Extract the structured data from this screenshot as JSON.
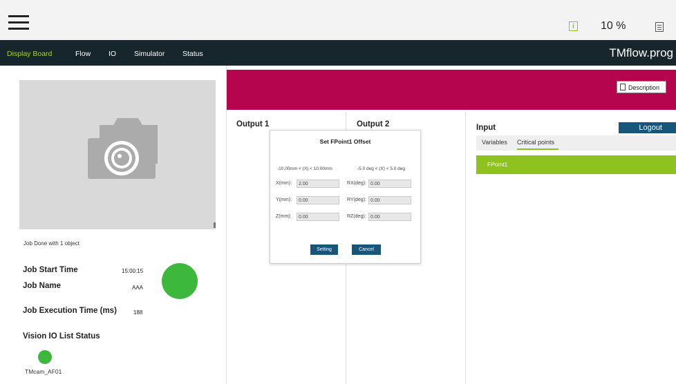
{
  "topbar": {
    "speed": "10 %"
  },
  "nav": {
    "items": [
      "Display Board",
      "Flow",
      "IO",
      "Simulator",
      "Status"
    ],
    "program_name": "TMflow.prog"
  },
  "left": {
    "job_done": "Job Done with 1 object",
    "job_start_time_label": "Job Start Time",
    "job_start_time_value": "15:00:15",
    "job_name_label": "Job Name",
    "job_name_value": "AAA",
    "exec_time_label": "Job Execution Time (ms)",
    "exec_time_value": "188",
    "vision_io_label": "Vision IO List Status",
    "camera_name": "TMcam_AF01"
  },
  "main": {
    "description_label": "Description",
    "output1": "Output 1",
    "output2": "Output 2",
    "input": "Input",
    "logout_label": "Logout",
    "tabs": [
      "Variables",
      "Critical points"
    ],
    "fpoint_item": "FPoint1"
  },
  "dialog": {
    "title": "Set FPoint1 Offset",
    "range_left": "-10.00mm < (X) < 10.00mm",
    "range_right": "-5.0 deg < (X) < 5.0 deg",
    "fields": {
      "x_label": "X(mm):",
      "x_value": "2.00",
      "y_label": "Y(mm):",
      "y_value": "0.00",
      "z_label": "Z(mm):",
      "z_value": "0.00",
      "rx_label": "RX(deg):",
      "rx_value": "0.00",
      "ry_label": "RY(deg):",
      "ry_value": "0.00",
      "rz_label": "RZ(deg):",
      "rz_value": "0.00"
    },
    "setting_label": "Setting",
    "cancel_label": "Cancel"
  },
  "colors": {
    "accent_green": "#8ec21f",
    "banner_magenta": "#b6054f",
    "button_blue": "#17557b",
    "navbar_dark": "#17252d",
    "status_green": "#3db83d"
  },
  "icons": [
    "menu-icon",
    "info-icon",
    "notes-icon",
    "camera-icon",
    "document-icon"
  ]
}
